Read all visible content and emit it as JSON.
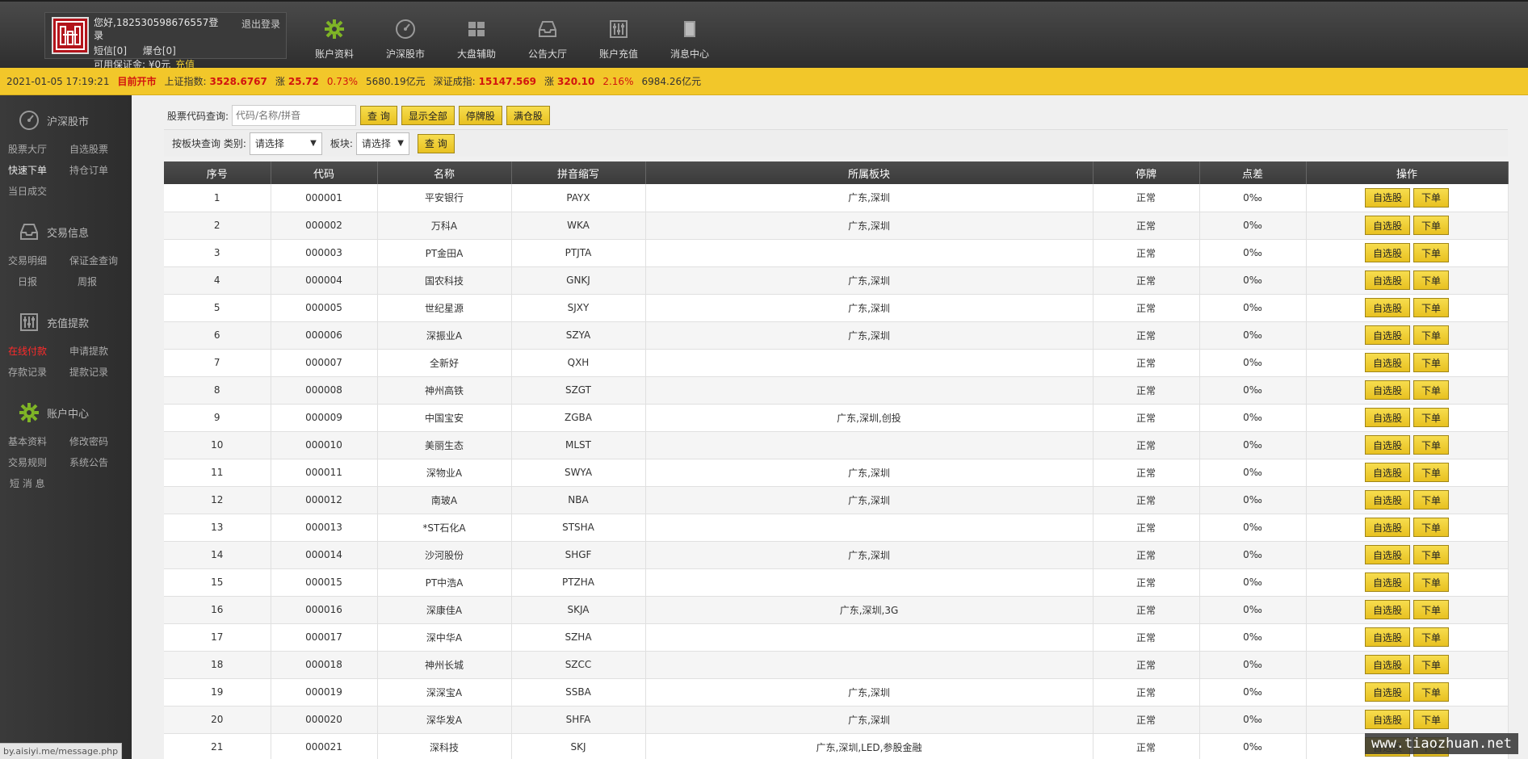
{
  "header": {
    "greeting": "您好,182530598676557登录",
    "logout": "退出登录",
    "sms": "短信[0]",
    "liquidation": "爆仓[0]",
    "margin_label": "可用保证金: ¥0元",
    "recharge": "充值",
    "nav": [
      {
        "label": "账户资料",
        "icon": "gear-icon"
      },
      {
        "label": "沪深股市",
        "icon": "gauge-icon"
      },
      {
        "label": "大盘辅助",
        "icon": "grid-icon"
      },
      {
        "label": "公告大厅",
        "icon": "inbox-icon"
      },
      {
        "label": "账户充值",
        "icon": "sliders-icon"
      },
      {
        "label": "消息中心",
        "icon": "book-icon"
      }
    ]
  },
  "ticker": {
    "datetime": "2021-01-05 17:19:21",
    "market_status": "目前开市",
    "sh_label": "上证指数:",
    "sh_value": "3528.6767",
    "sh_change_label": "涨",
    "sh_change": "25.72",
    "sh_pct": "0.73%",
    "sh_turnover": "5680.19亿元",
    "sz_label": "深证成指:",
    "sz_value": "15147.569",
    "sz_change_label": "涨",
    "sz_change": "320.10",
    "sz_pct": "2.16%",
    "sz_turnover": "6984.26亿元"
  },
  "sidebar": {
    "groups": [
      {
        "title": "沪深股市",
        "items": [
          "股票大厅",
          "自选股票",
          "快速下单",
          "持仓订单",
          "当日成交"
        ]
      },
      {
        "title": "交易信息",
        "items": [
          "交易明细",
          "保证金查询",
          "日报",
          "周报"
        ]
      },
      {
        "title": "充值提款",
        "items": [
          "在线付款",
          "申请提款",
          "存款记录",
          "提款记录"
        ]
      },
      {
        "title": "账户中心",
        "items": [
          "基本资料",
          "修改密码",
          "交易规则",
          "系统公告",
          "短 消 息"
        ]
      }
    ],
    "status_url": "by.aisiyi.me/message.php"
  },
  "search": {
    "label": "股票代码查询:",
    "placeholder": "代码/名称/拼音",
    "query_btn": "查 询",
    "show_all_btn": "显示全部",
    "suspended_btn": "停牌股",
    "full_btn": "满仓股"
  },
  "filter": {
    "label": "按板块查询 类别:",
    "category_value": "请选择",
    "sector_label": "板块:",
    "sector_value": "请选择",
    "query_btn": "查 询"
  },
  "table": {
    "columns": [
      "序号",
      "代码",
      "名称",
      "拼音缩写",
      "所属板块",
      "停牌",
      "点差",
      "操作"
    ],
    "watch_btn": "自选股",
    "order_btn": "下单",
    "rows": [
      [
        "1",
        "000001",
        "平安银行",
        "PAYX",
        "广东,深圳",
        "正常",
        "0‰"
      ],
      [
        "2",
        "000002",
        "万科A",
        "WKA",
        "广东,深圳",
        "正常",
        "0‰"
      ],
      [
        "3",
        "000003",
        "PT金田A",
        "PTJTA",
        "",
        "正常",
        "0‰"
      ],
      [
        "4",
        "000004",
        "国农科技",
        "GNKJ",
        "广东,深圳",
        "正常",
        "0‰"
      ],
      [
        "5",
        "000005",
        "世纪星源",
        "SJXY",
        "广东,深圳",
        "正常",
        "0‰"
      ],
      [
        "6",
        "000006",
        "深振业A",
        "SZYA",
        "广东,深圳",
        "正常",
        "0‰"
      ],
      [
        "7",
        "000007",
        "全新好",
        "QXH",
        "",
        "正常",
        "0‰"
      ],
      [
        "8",
        "000008",
        "神州高铁",
        "SZGT",
        "",
        "正常",
        "0‰"
      ],
      [
        "9",
        "000009",
        "中国宝安",
        "ZGBA",
        "广东,深圳,创投",
        "正常",
        "0‰"
      ],
      [
        "10",
        "000010",
        "美丽生态",
        "MLST",
        "",
        "正常",
        "0‰"
      ],
      [
        "11",
        "000011",
        "深物业A",
        "SWYA",
        "广东,深圳",
        "正常",
        "0‰"
      ],
      [
        "12",
        "000012",
        "南玻A",
        "NBA",
        "广东,深圳",
        "正常",
        "0‰"
      ],
      [
        "13",
        "000013",
        "*ST石化A",
        "STSHA",
        "",
        "正常",
        "0‰"
      ],
      [
        "14",
        "000014",
        "沙河股份",
        "SHGF",
        "广东,深圳",
        "正常",
        "0‰"
      ],
      [
        "15",
        "000015",
        "PT中浩A",
        "PTZHA",
        "",
        "正常",
        "0‰"
      ],
      [
        "16",
        "000016",
        "深康佳A",
        "SKJA",
        "广东,深圳,3G",
        "正常",
        "0‰"
      ],
      [
        "17",
        "000017",
        "深中华A",
        "SZHA",
        "",
        "正常",
        "0‰"
      ],
      [
        "18",
        "000018",
        "神州长城",
        "SZCC",
        "",
        "正常",
        "0‰"
      ],
      [
        "19",
        "000019",
        "深深宝A",
        "SSBA",
        "广东,深圳",
        "正常",
        "0‰"
      ],
      [
        "20",
        "000020",
        "深华发A",
        "SHFA",
        "广东,深圳",
        "正常",
        "0‰"
      ],
      [
        "21",
        "000021",
        "深科技",
        "SKJ",
        "广东,深圳,LED,参股金融",
        "正常",
        "0‰"
      ]
    ]
  },
  "watermark": "www.tiaozhuan.net",
  "colors": {
    "accent": "#f2c72a",
    "rise": "#d2140f",
    "sidebar": "#333333",
    "header": "#3a3a3a"
  }
}
